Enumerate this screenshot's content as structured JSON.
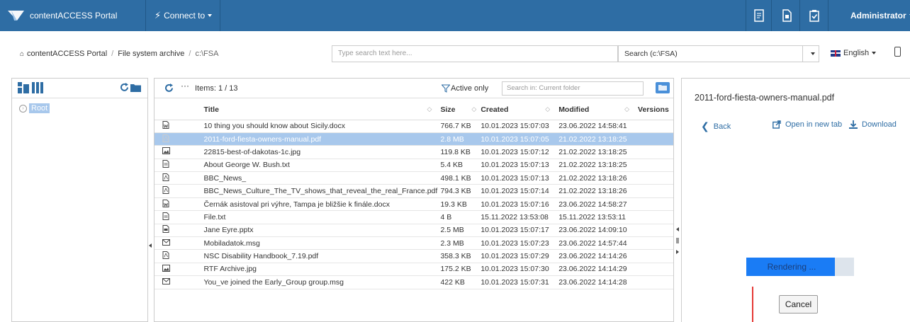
{
  "app": {
    "title": "contentACCESS Portal",
    "connect_label": "Connect to",
    "user": "Administrator"
  },
  "breadcrumb": {
    "home": "contentACCESS Portal",
    "archive": "File system archive",
    "path": "c:\\FSA"
  },
  "search": {
    "placeholder": "Type search text here...",
    "scope": "Search (c:\\FSA)"
  },
  "language": "English",
  "tree": {
    "root_label": "Root"
  },
  "list": {
    "items_label": "Items: 1 / 13",
    "active_only": "Active only",
    "folder_search_placeholder": "Search in: Current folder",
    "columns": {
      "title": "Title",
      "size": "Size",
      "created": "Created",
      "modified": "Modified",
      "versions": "Versions"
    },
    "rows": [
      {
        "icon": "word-doc-icon",
        "title": "10 thing you should know about Sicily.docx",
        "size": "766.7 KB",
        "created": "10.01.2023 15:07:03",
        "modified": "23.06.2022 14:58:41"
      },
      {
        "icon": "pdf-icon",
        "title": "2011-ford-fiesta-owners-manual.pdf",
        "size": "2.8 MB",
        "created": "10.01.2023 15:07:05",
        "modified": "21.02.2022 13:18:25"
      },
      {
        "icon": "image-icon",
        "title": "22815-best-of-dakotas-1c.jpg",
        "size": "119.8 KB",
        "created": "10.01.2023 15:07:12",
        "modified": "21.02.2022 13:18:25"
      },
      {
        "icon": "text-file-icon",
        "title": "About George W. Bush.txt",
        "size": "5.4 KB",
        "created": "10.01.2023 15:07:13",
        "modified": "21.02.2022 13:18:25"
      },
      {
        "icon": "pdf-icon",
        "title": "BBC_News_",
        "size": "498.1 KB",
        "created": "10.01.2023 15:07:13",
        "modified": "21.02.2022 13:18:26"
      },
      {
        "icon": "pdf-icon",
        "title": "BBC_News_Culture_The_TV_shows_that_reveal_the_real_France.pdf",
        "size": "794.3 KB",
        "created": "10.01.2023 15:07:14",
        "modified": "21.02.2022 13:18:26"
      },
      {
        "icon": "word-doc-icon",
        "title": "Černák asistoval pri výhre, Tampa je bližšie k finále.docx",
        "size": "19.3 KB",
        "created": "10.01.2023 15:07:16",
        "modified": "23.06.2022 14:58:27"
      },
      {
        "icon": "text-file-icon",
        "title": "File.txt",
        "size": "4 B",
        "created": "15.11.2022 13:53:08",
        "modified": "15.11.2022 13:53:11"
      },
      {
        "icon": "presentation-icon",
        "title": "Jane Eyre.pptx",
        "size": "2.5 MB",
        "created": "10.01.2023 15:07:17",
        "modified": "23.06.2022 14:09:10"
      },
      {
        "icon": "mail-icon",
        "title": "Mobiladatok.msg",
        "size": "2.3 MB",
        "created": "10.01.2023 15:07:23",
        "modified": "23.06.2022 14:57:44"
      },
      {
        "icon": "pdf-icon",
        "title": "NSC Disability Handbook_7.19.pdf",
        "size": "358.3 KB",
        "created": "10.01.2023 15:07:29",
        "modified": "23.06.2022 14:14:26"
      },
      {
        "icon": "image-icon",
        "title": "RTF Archive.jpg",
        "size": "175.2 KB",
        "created": "10.01.2023 15:07:30",
        "modified": "23.06.2022 14:14:29"
      },
      {
        "icon": "mail-icon",
        "title": "You_ve joined the Early_Group group.msg",
        "size": "422 KB",
        "created": "10.01.2023 15:07:31",
        "modified": "23.06.2022 14:14:28"
      }
    ]
  },
  "preview": {
    "title": "2011-ford-fiesta-owners-manual.pdf",
    "back": "Back",
    "open_new_tab": "Open in new tab",
    "download": "Download",
    "rendering": "Rendering ...",
    "rendering_progress": 0.82,
    "cancel": "Cancel"
  },
  "colors": {
    "nav": "#2e6da4",
    "selection": "#a8c8ec",
    "progress": "#1a7cf5"
  }
}
